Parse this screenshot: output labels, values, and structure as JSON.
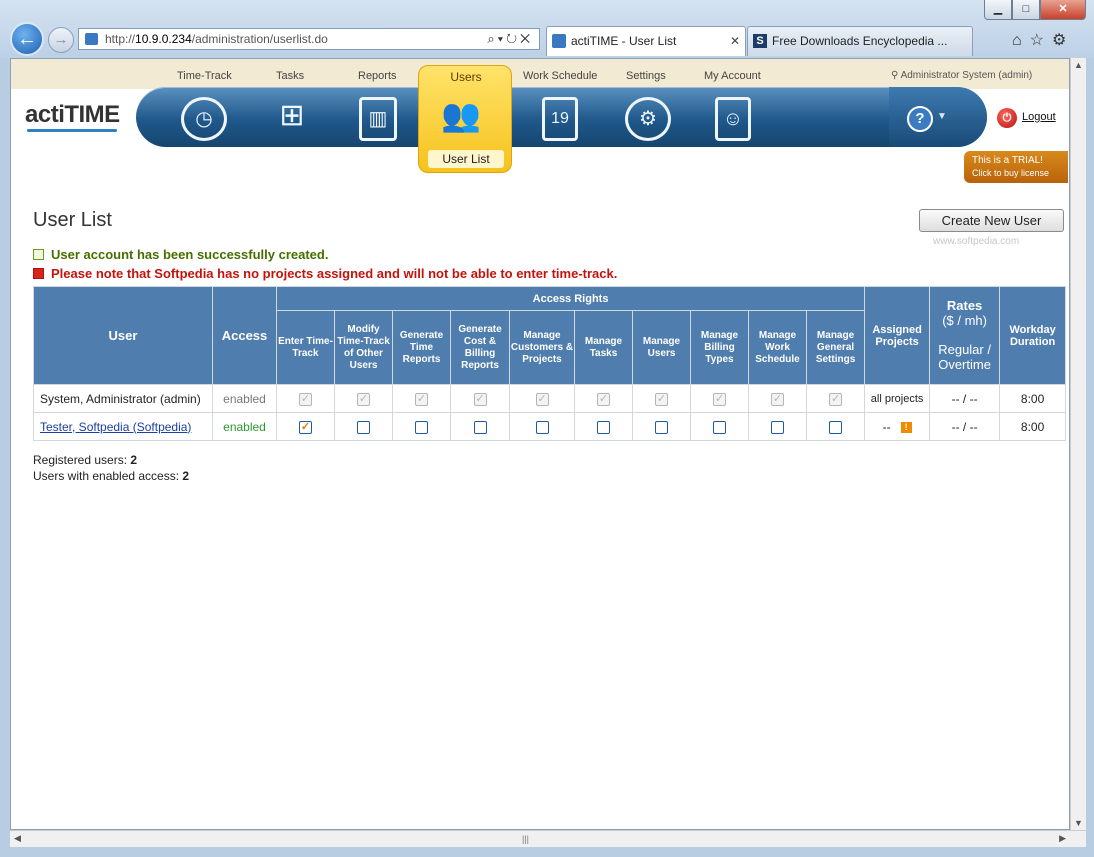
{
  "browser": {
    "address": {
      "prefix": "http://",
      "host": "10.9.0.234",
      "path": "/administration/userlist.do"
    },
    "tabs": [
      {
        "label": "actiTIME - User List",
        "close": "✕"
      },
      {
        "label": "Free Downloads Encyclopedia ...",
        "icon_letter": "S"
      }
    ],
    "window_controls": {
      "minimize": "▁",
      "maximize": "□",
      "close": "✕"
    }
  },
  "app": {
    "logo": "actiTIME",
    "menu": [
      "Time-Track",
      "Tasks",
      "Reports",
      "Users",
      "Work Schedule",
      "Settings",
      "My Account"
    ],
    "active_menu": "Users",
    "active_submenu": "User List",
    "user_info": "Administrator System (admin)",
    "logout": "Logout",
    "help_icon": "?",
    "trial": {
      "line1": "This is a TRIAL!",
      "line2": "Click to buy license"
    }
  },
  "page": {
    "title": "User List",
    "create_button": "Create New User",
    "watermark": "www.softpedia.com",
    "messages": {
      "success": "User account has been successfully created.",
      "warning": "Please note that Softpedia has no projects assigned and will not be able to enter time-track."
    }
  },
  "table": {
    "headers": {
      "user": "User",
      "access": "Access",
      "access_rights": "Access Rights",
      "rights": [
        "Enter Time-Track",
        "Modify Time-Track of Other Users",
        "Generate Time Reports",
        "Generate Cost & Billing Reports",
        "Manage Customers & Projects",
        "Manage Tasks",
        "Manage Users",
        "Manage Billing Types",
        "Manage Work Schedule",
        "Manage General Settings"
      ],
      "assigned_projects": "Assigned Projects",
      "rates_title": "Rates",
      "rates_unit": "($ / mh)",
      "rates_sub": "Regular / Overtime",
      "workday_duration": "Workday Duration"
    },
    "rows": [
      {
        "user": "System, Administrator (admin)",
        "access": "enabled",
        "assigned_projects": "all projects",
        "rates": "-- / --",
        "workday": "8:00",
        "rights": [
          true,
          true,
          true,
          true,
          true,
          true,
          true,
          true,
          true,
          true
        ],
        "editable": false
      },
      {
        "user": "Tester, Softpedia (Softpedia)",
        "access": "enabled",
        "assigned_projects": "--",
        "rates": "-- / --",
        "workday": "8:00",
        "rights": [
          true,
          false,
          false,
          false,
          false,
          false,
          false,
          false,
          false,
          false
        ],
        "editable": true
      }
    ]
  },
  "summary": {
    "registered_label": "Registered users:",
    "registered_value": "2",
    "enabled_label": "Users with enabled access:",
    "enabled_value": "2"
  },
  "colors": {
    "header_blue": "#4f7dae",
    "nav_blue": "#1f588b",
    "users_tab": "#f6c21d",
    "success_green": "#476f00",
    "error_red": "#c4130d"
  }
}
